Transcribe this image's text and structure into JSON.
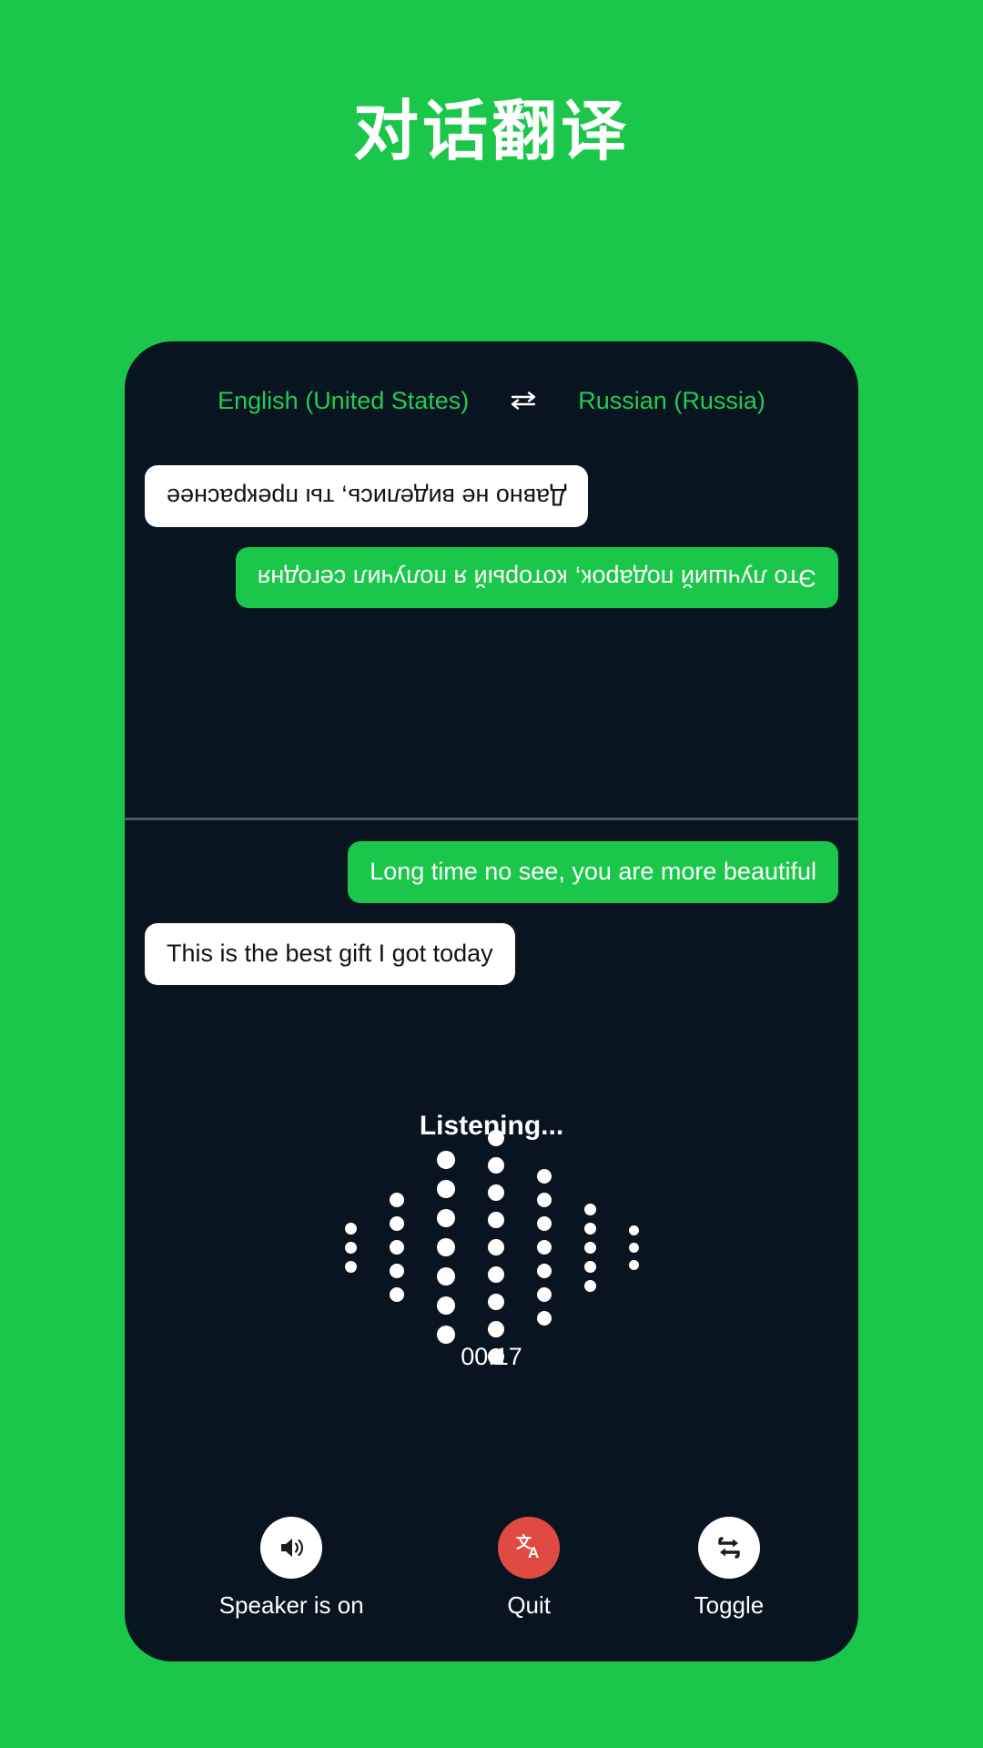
{
  "theme": {
    "background_green": "#1bc74a",
    "card_background": "#081521",
    "accent_green": "#22cc55",
    "quit_red": "#e04a42",
    "bubble_white": "#ffffff",
    "text_white": "#ffffff",
    "divider": "#4d5a66"
  },
  "header": {
    "title": "对话翻译"
  },
  "language_bar": {
    "source_language": "English (United States)",
    "swap_icon": "swap-arrows-icon",
    "target_language": "Russian (Russia)"
  },
  "conversation": {
    "top_panel": {
      "rotated": true,
      "messages": [
        {
          "text": "Это лучший подарок, который я получил сегодня",
          "style": "green",
          "align": "left",
          "language": "ru"
        },
        {
          "text": "Давно не виделись, ты прекраснее",
          "style": "white",
          "align": "right",
          "language": "ru"
        }
      ]
    },
    "bottom_panel": {
      "rotated": false,
      "messages": [
        {
          "text": "Long time no see, you are more beautiful",
          "style": "green",
          "align": "right",
          "language": "en"
        },
        {
          "text": "This is the best gift I got today",
          "style": "white",
          "align": "left",
          "language": "en"
        }
      ]
    }
  },
  "status": {
    "listening_label": "Listening...",
    "timer": "00:17"
  },
  "waveform": {
    "columns": [
      {
        "dots": 3,
        "size": 13
      },
      {
        "dots": 5,
        "size": 16
      },
      {
        "dots": 7,
        "size": 20
      },
      {
        "dots": 9,
        "size": 18
      },
      {
        "dots": 7,
        "size": 16
      },
      {
        "dots": 5,
        "size": 13
      },
      {
        "dots": 3,
        "size": 11
      }
    ]
  },
  "controls": [
    {
      "id": "speaker",
      "label": "Speaker is on",
      "icon": "speaker-on-icon",
      "circle_style": "light"
    },
    {
      "id": "quit",
      "label": "Quit",
      "icon": "translate-icon",
      "circle_style": "red"
    },
    {
      "id": "toggle",
      "label": "Toggle",
      "icon": "repeat-toggle-icon",
      "circle_style": "light"
    }
  ]
}
